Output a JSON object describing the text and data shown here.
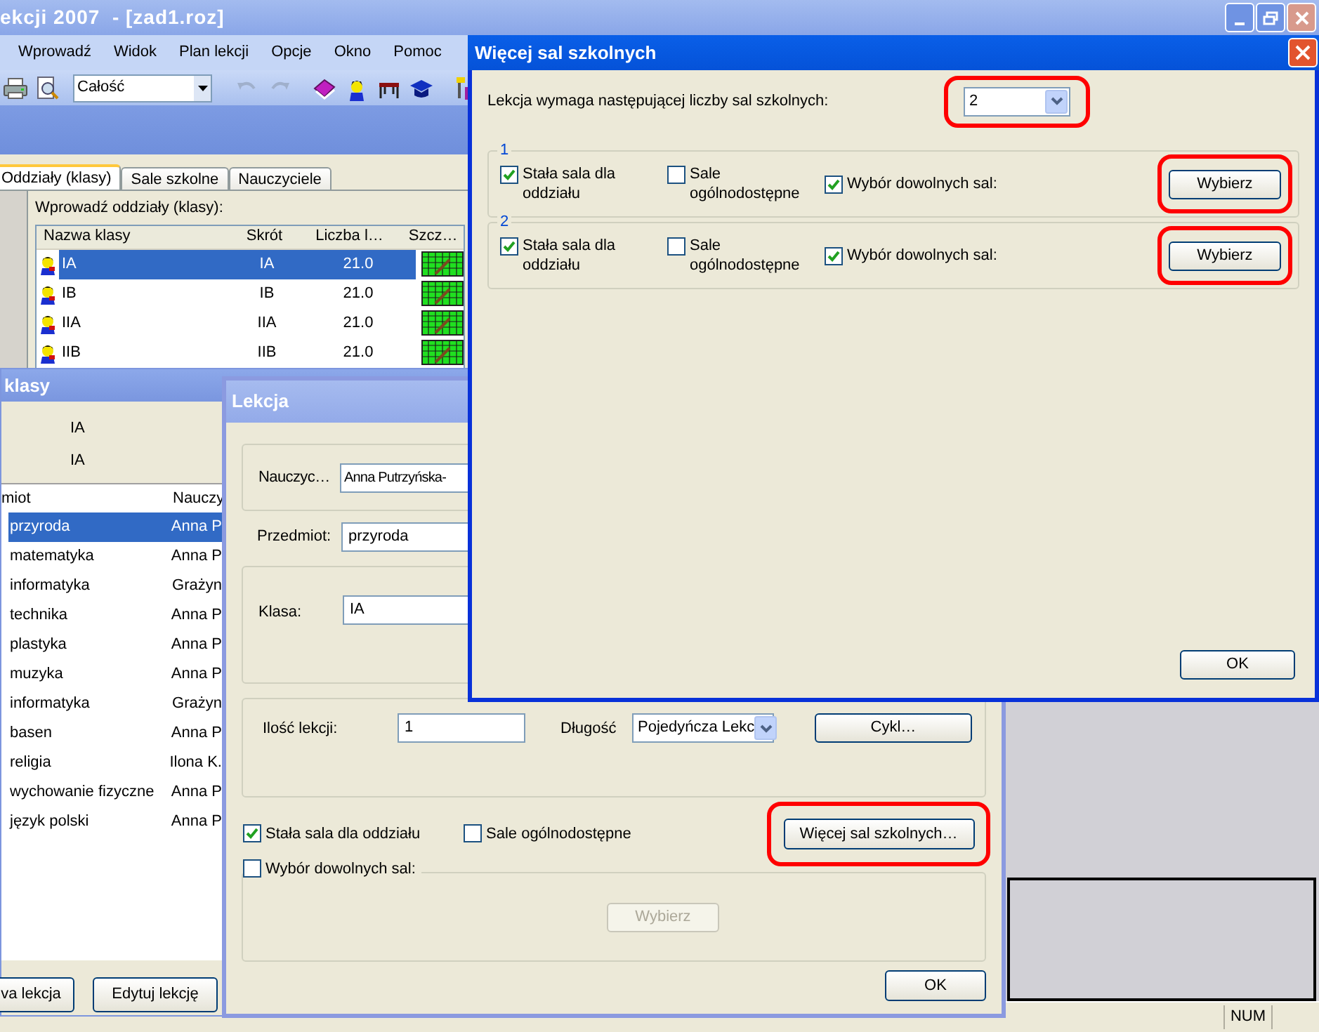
{
  "main_window": {
    "title": "ekcji 2007  - [zad1.roz]",
    "menu": [
      "Wprowadź",
      "Widok",
      "Plan lekcji",
      "Opcje",
      "Okno",
      "Pomoc"
    ],
    "view_select": "Całość",
    "status_indicator": "NUM"
  },
  "classes_panel": {
    "tabs": [
      {
        "label": "Oddziały (klasy)",
        "selected": true
      },
      {
        "label": "Sale szkolne",
        "selected": false
      },
      {
        "label": "Nauczyciele",
        "selected": false
      }
    ],
    "prompt": "Wprowadź oddziały (klasy):",
    "columns": [
      "Nazwa klasy",
      "Skrót",
      "Liczba l…",
      "Szcz…"
    ],
    "rows": [
      {
        "name": "IA",
        "short": "IA",
        "count": "21.0",
        "selected": true
      },
      {
        "name": "IB",
        "short": "IB",
        "count": "21.0",
        "selected": false
      },
      {
        "name": "IIA",
        "short": "IIA",
        "count": "21.0",
        "selected": false
      },
      {
        "name": "IIB",
        "short": "IIB",
        "count": "21.0",
        "selected": false
      }
    ]
  },
  "class_window": {
    "title": "klasy",
    "values": [
      "IA",
      "IA"
    ],
    "columns": [
      "miot",
      "Nauczy"
    ],
    "rows": [
      {
        "subject": "przyroda",
        "teacher": "Anna P",
        "selected": true
      },
      {
        "subject": "matematyka",
        "teacher": "Anna P",
        "selected": false
      },
      {
        "subject": "informatyka",
        "teacher": "Grażyn",
        "selected": false
      },
      {
        "subject": "technika",
        "teacher": "Anna P",
        "selected": false
      },
      {
        "subject": "plastyka",
        "teacher": "Anna P",
        "selected": false
      },
      {
        "subject": "muzyka",
        "teacher": "Anna P",
        "selected": false
      },
      {
        "subject": "informatyka",
        "teacher": "Grażyn",
        "selected": false
      },
      {
        "subject": "basen",
        "teacher": "Anna P",
        "selected": false
      },
      {
        "subject": "religia",
        "teacher": "Ilona K.",
        "selected": false
      },
      {
        "subject": "wychowanie fizyczne",
        "teacher": "Anna P",
        "selected": false
      },
      {
        "subject": "język polski",
        "teacher": "Anna P",
        "selected": false
      }
    ],
    "buttons": [
      "va lekcja",
      "Edytuj lekcję"
    ]
  },
  "lesson_dialog": {
    "title": "Lekcja",
    "teacher": {
      "label": "Nauczyc…",
      "value": "Anna Putrzyńska-"
    },
    "subject": {
      "label": "Przedmiot:",
      "value": "przyroda"
    },
    "class": {
      "label": "Klasa:",
      "value": "IA"
    },
    "count": {
      "label": "Ilość lekcji:",
      "value": "1"
    },
    "length": {
      "label": "Długość",
      "value": "Pojedyńcza Lekc"
    },
    "cycle_button": "Cykl…",
    "options": [
      {
        "label": "Stała sala dla oddziału",
        "checked": true
      },
      {
        "label": "Sale ogólnodostępne",
        "checked": false
      }
    ],
    "more_rooms_button": {
      "label": "Więcej sal szkolnych…",
      "highlighted": true
    },
    "free_choice": {
      "label": "Wybór dowolnych sal:",
      "checked": false
    },
    "choose_button": {
      "label": "Wybierz",
      "disabled": true
    },
    "ok_button": "OK"
  },
  "rooms_dialog": {
    "title": "Więcej sal szkolnych",
    "prompt": "Lekcja wymaga następującej liczby sal szkolnych:",
    "room_count": {
      "value": "2",
      "highlighted": true
    },
    "rooms": [
      {
        "legend": "1",
        "fixed_room": {
          "label": "Stała sala dla oddziału",
          "checked": true
        },
        "public_rooms": {
          "label": "Sale ogólnodostępne",
          "checked": false
        },
        "free_choice": {
          "label": "Wybór dowolnych sal:",
          "checked": true
        },
        "choose_button": {
          "label": "Wybierz",
          "highlighted": true
        }
      },
      {
        "legend": "2",
        "fixed_room": {
          "label": "Stała sala dla oddziału",
          "checked": true
        },
        "public_rooms": {
          "label": "Sale ogólnodostępne",
          "checked": false
        },
        "free_choice": {
          "label": "Wybór dowolnych sal:",
          "checked": true
        },
        "choose_button": {
          "label": "Wybierz",
          "highlighted": true
        }
      }
    ],
    "ok_button": "OK"
  }
}
